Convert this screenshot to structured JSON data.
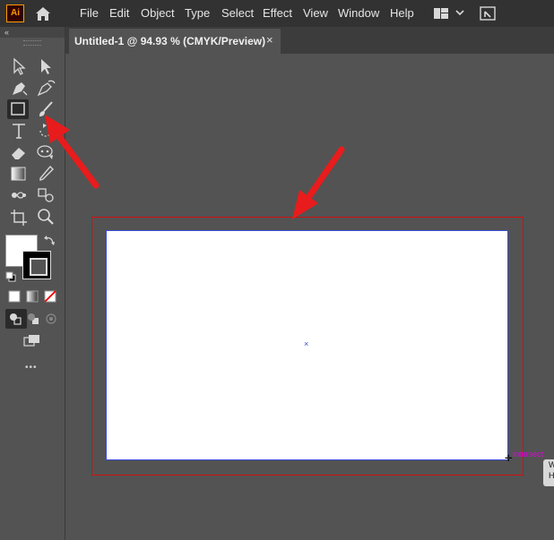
{
  "app": {
    "logo_text": "Ai",
    "accent": "#ff9a00"
  },
  "menu": {
    "items": [
      "File",
      "Edit",
      "Object",
      "Type",
      "Select",
      "Effect",
      "View",
      "Window",
      "Help"
    ]
  },
  "document": {
    "tab_title": "Untitled-1 @ 94.93 % (CMYK/Preview)",
    "close_glyph": "×"
  },
  "toolbar": {
    "collapse_glyph": "«",
    "more_glyph": "•••",
    "tools": [
      [
        "selection-tool",
        "direct-selection-tool"
      ],
      [
        "pen-tool",
        "curvature-tool"
      ],
      [
        "rectangle-tool",
        "paintbrush-tool"
      ],
      [
        "type-tool",
        "rotate-tool"
      ],
      [
        "eraser-tool",
        "puppet-warp-tool"
      ],
      [
        "gradient-tool",
        "eyedropper-tool"
      ],
      [
        "blend-tool",
        "symbol-sprayer-tool"
      ],
      [
        "artboard-tool",
        "zoom-tool"
      ]
    ]
  },
  "canvas": {
    "smart_guide_label": "intersect",
    "tooltip_lines": [
      "W",
      "H"
    ],
    "bleed_color": "#d21010",
    "artboard_color": "#ffffff"
  },
  "annotations": {
    "arrow_color": "#e81c1c"
  }
}
